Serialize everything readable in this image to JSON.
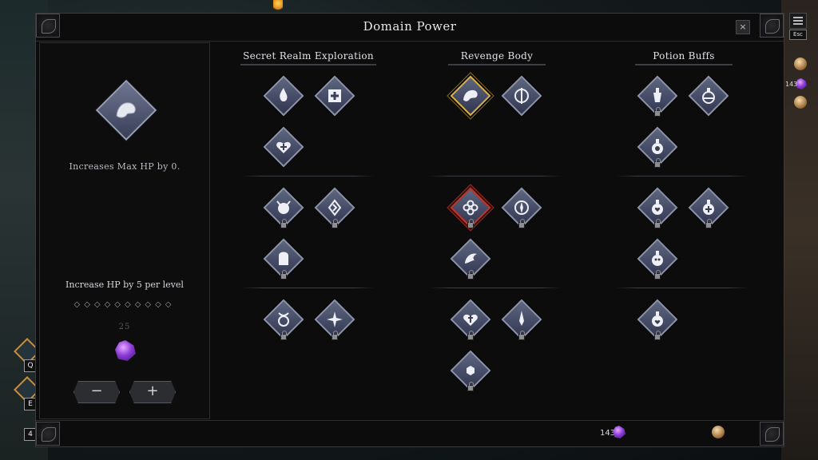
{
  "window": {
    "title": "Domain Power",
    "close_label": "×"
  },
  "info": {
    "description": "Increases Max HP by 0.",
    "level_text": "Increase HP by 5 per level",
    "pips": "◇◇◇◇◇◇◇◇◇◇",
    "cost": "25",
    "minus_label": "−",
    "plus_label": "+"
  },
  "columns": [
    {
      "title": "Secret Realm Exploration"
    },
    {
      "title": "Revenge Body"
    },
    {
      "title": "Potion Buffs"
    }
  ],
  "nodes": [
    {
      "name": "secret-realm-node-1",
      "icon": "flame-icon",
      "locked": false
    },
    {
      "name": "secret-realm-node-2",
      "icon": "first-aid-icon",
      "locked": false
    },
    {
      "name": "secret-realm-node-3",
      "icon": "heart-plus-icon",
      "locked": false
    },
    {
      "name": "secret-realm-node-4",
      "icon": "demon-icon",
      "locked": true
    },
    {
      "name": "secret-realm-node-5",
      "icon": "rune-icon",
      "locked": true
    },
    {
      "name": "secret-realm-node-6",
      "icon": "tombstone-icon",
      "locked": true
    },
    {
      "name": "secret-realm-node-7",
      "icon": "amulet-icon",
      "locked": true
    },
    {
      "name": "secret-realm-node-8",
      "icon": "star-burst-icon",
      "locked": true
    },
    {
      "name": "revenge-body-node-1",
      "icon": "muscle-icon",
      "locked": false,
      "selected": true
    },
    {
      "name": "revenge-body-node-2",
      "icon": "blade-shield-icon",
      "locked": false
    },
    {
      "name": "revenge-body-node-3",
      "icon": "clover-icon",
      "locked": true,
      "hover": true
    },
    {
      "name": "revenge-body-node-4",
      "icon": "shuriken-icon",
      "locked": true
    },
    {
      "name": "revenge-body-node-5",
      "icon": "dragon-icon",
      "locked": true
    },
    {
      "name": "revenge-body-node-6",
      "icon": "heart-cross-icon",
      "locked": true
    },
    {
      "name": "revenge-body-node-7",
      "icon": "dagger-icon",
      "locked": true
    },
    {
      "name": "revenge-body-node-8",
      "icon": "hexagon-icon",
      "locked": true
    },
    {
      "name": "potion-buffs-node-1",
      "icon": "potion-bottle-icon",
      "locked": true
    },
    {
      "name": "potion-buffs-node-2",
      "icon": "round-flask-icon",
      "locked": false
    },
    {
      "name": "potion-buffs-node-3",
      "icon": "potion-drop-icon",
      "locked": true
    },
    {
      "name": "potion-buffs-node-4",
      "icon": "potion-heart-icon",
      "locked": true
    },
    {
      "name": "potion-buffs-node-5",
      "icon": "potion-cross-icon",
      "locked": true
    },
    {
      "name": "potion-buffs-node-6",
      "icon": "potion-skull-icon",
      "locked": true
    },
    {
      "name": "potion-buffs-node-7",
      "icon": "potion-shield-icon",
      "locked": true
    }
  ],
  "currency": {
    "gems": "143"
  },
  "hud": {
    "esc_label": "Esc",
    "gem_count": "143",
    "key_q": "Q",
    "key_e": "E",
    "key_4": "4"
  },
  "colors": {
    "selected_border": "#d9b24a",
    "hover_border": "#c0392b",
    "node_fill": "#5e6680"
  }
}
